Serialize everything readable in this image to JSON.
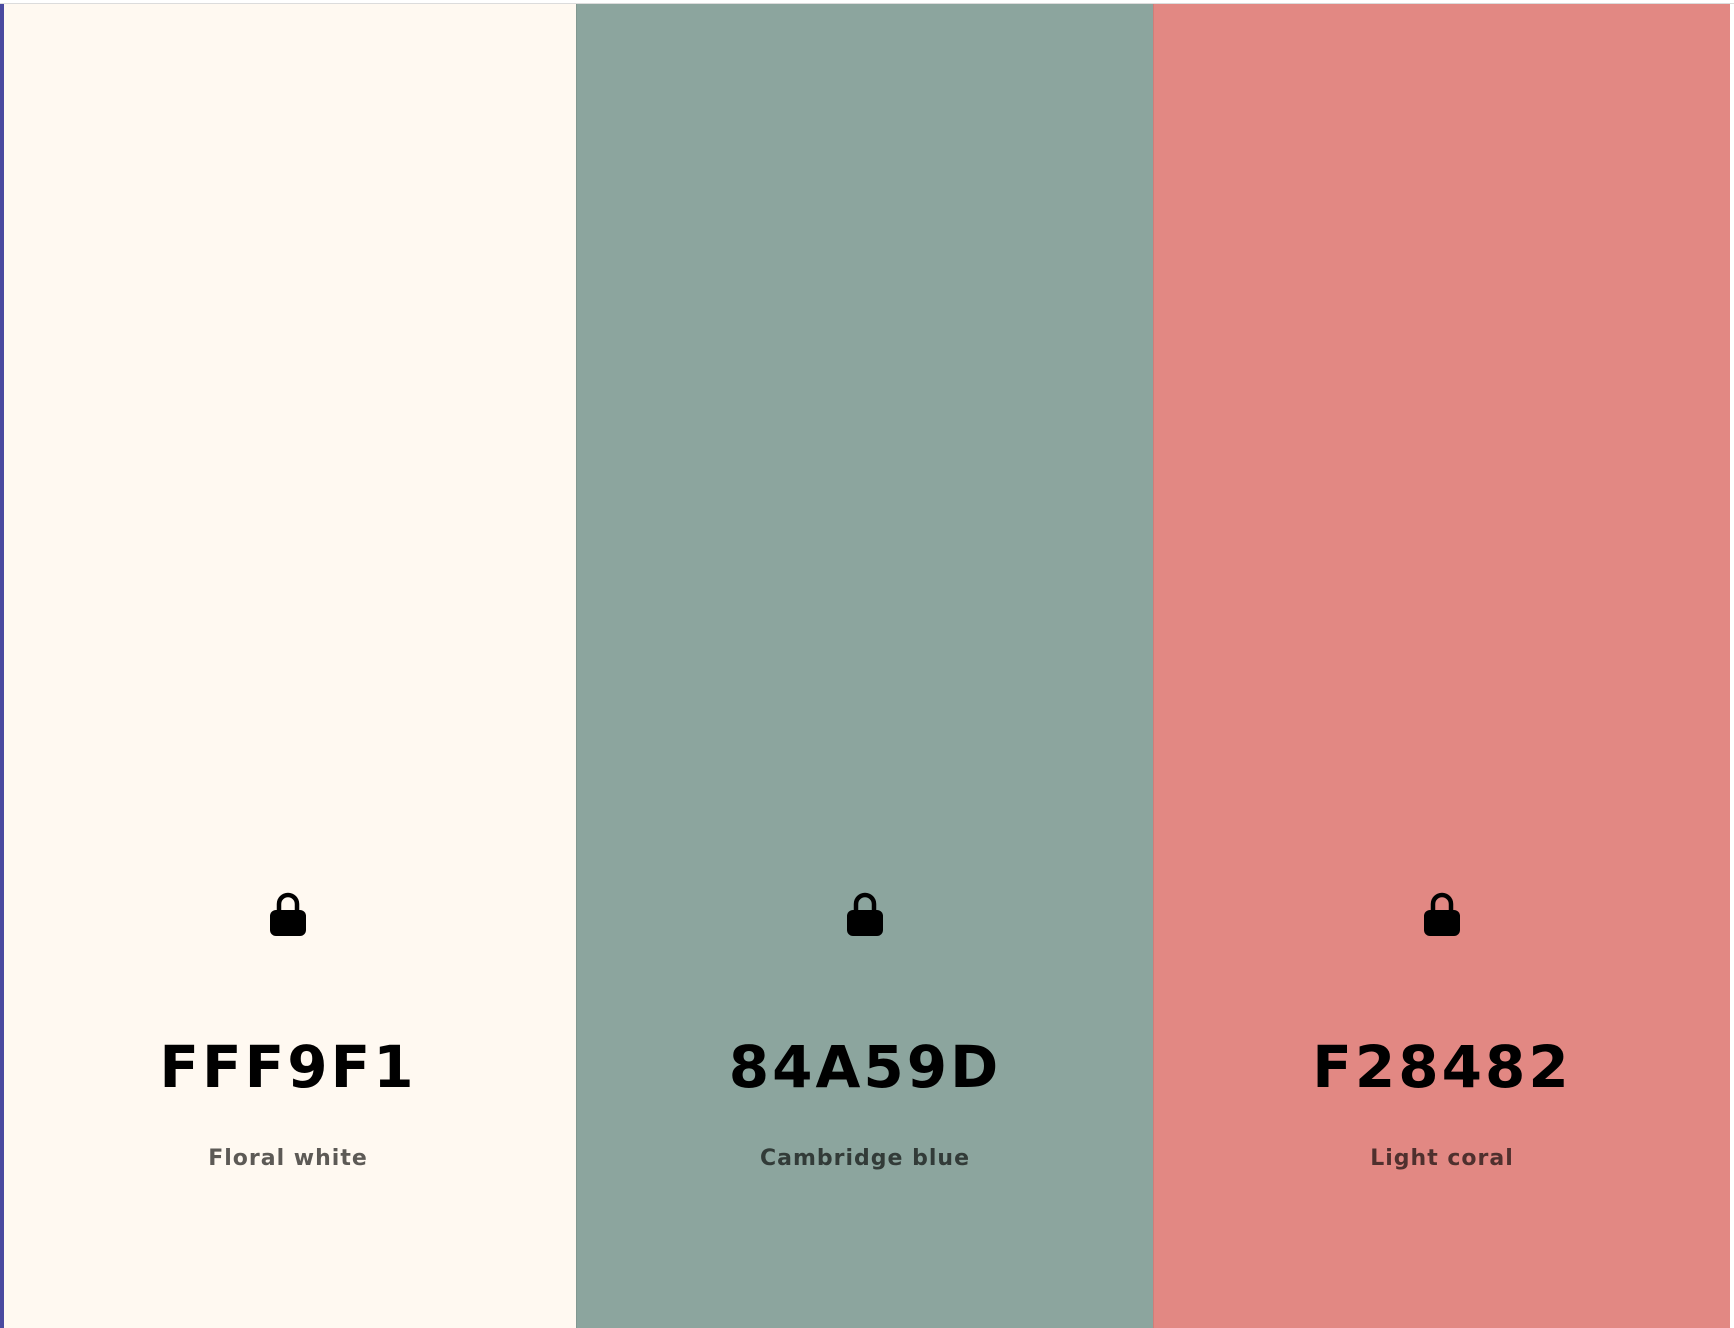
{
  "ui": {
    "accent_edge_color": "#4a4aa0"
  },
  "palette": {
    "swatches": [
      {
        "hex": "FFF9F1",
        "name": "Floral white",
        "background": "#fff9f1",
        "name_color": "#5d5a56",
        "locked": true,
        "icon": "lock-icon"
      },
      {
        "hex": "84A59D",
        "name": "Cambridge blue",
        "background": "#8ca59e",
        "name_color": "#323b38",
        "locked": true,
        "icon": "lock-icon"
      },
      {
        "hex": "F28482",
        "name": "Light coral",
        "background": "#e28883",
        "name_color": "#4f302e",
        "locked": true,
        "icon": "lock-icon"
      }
    ]
  }
}
